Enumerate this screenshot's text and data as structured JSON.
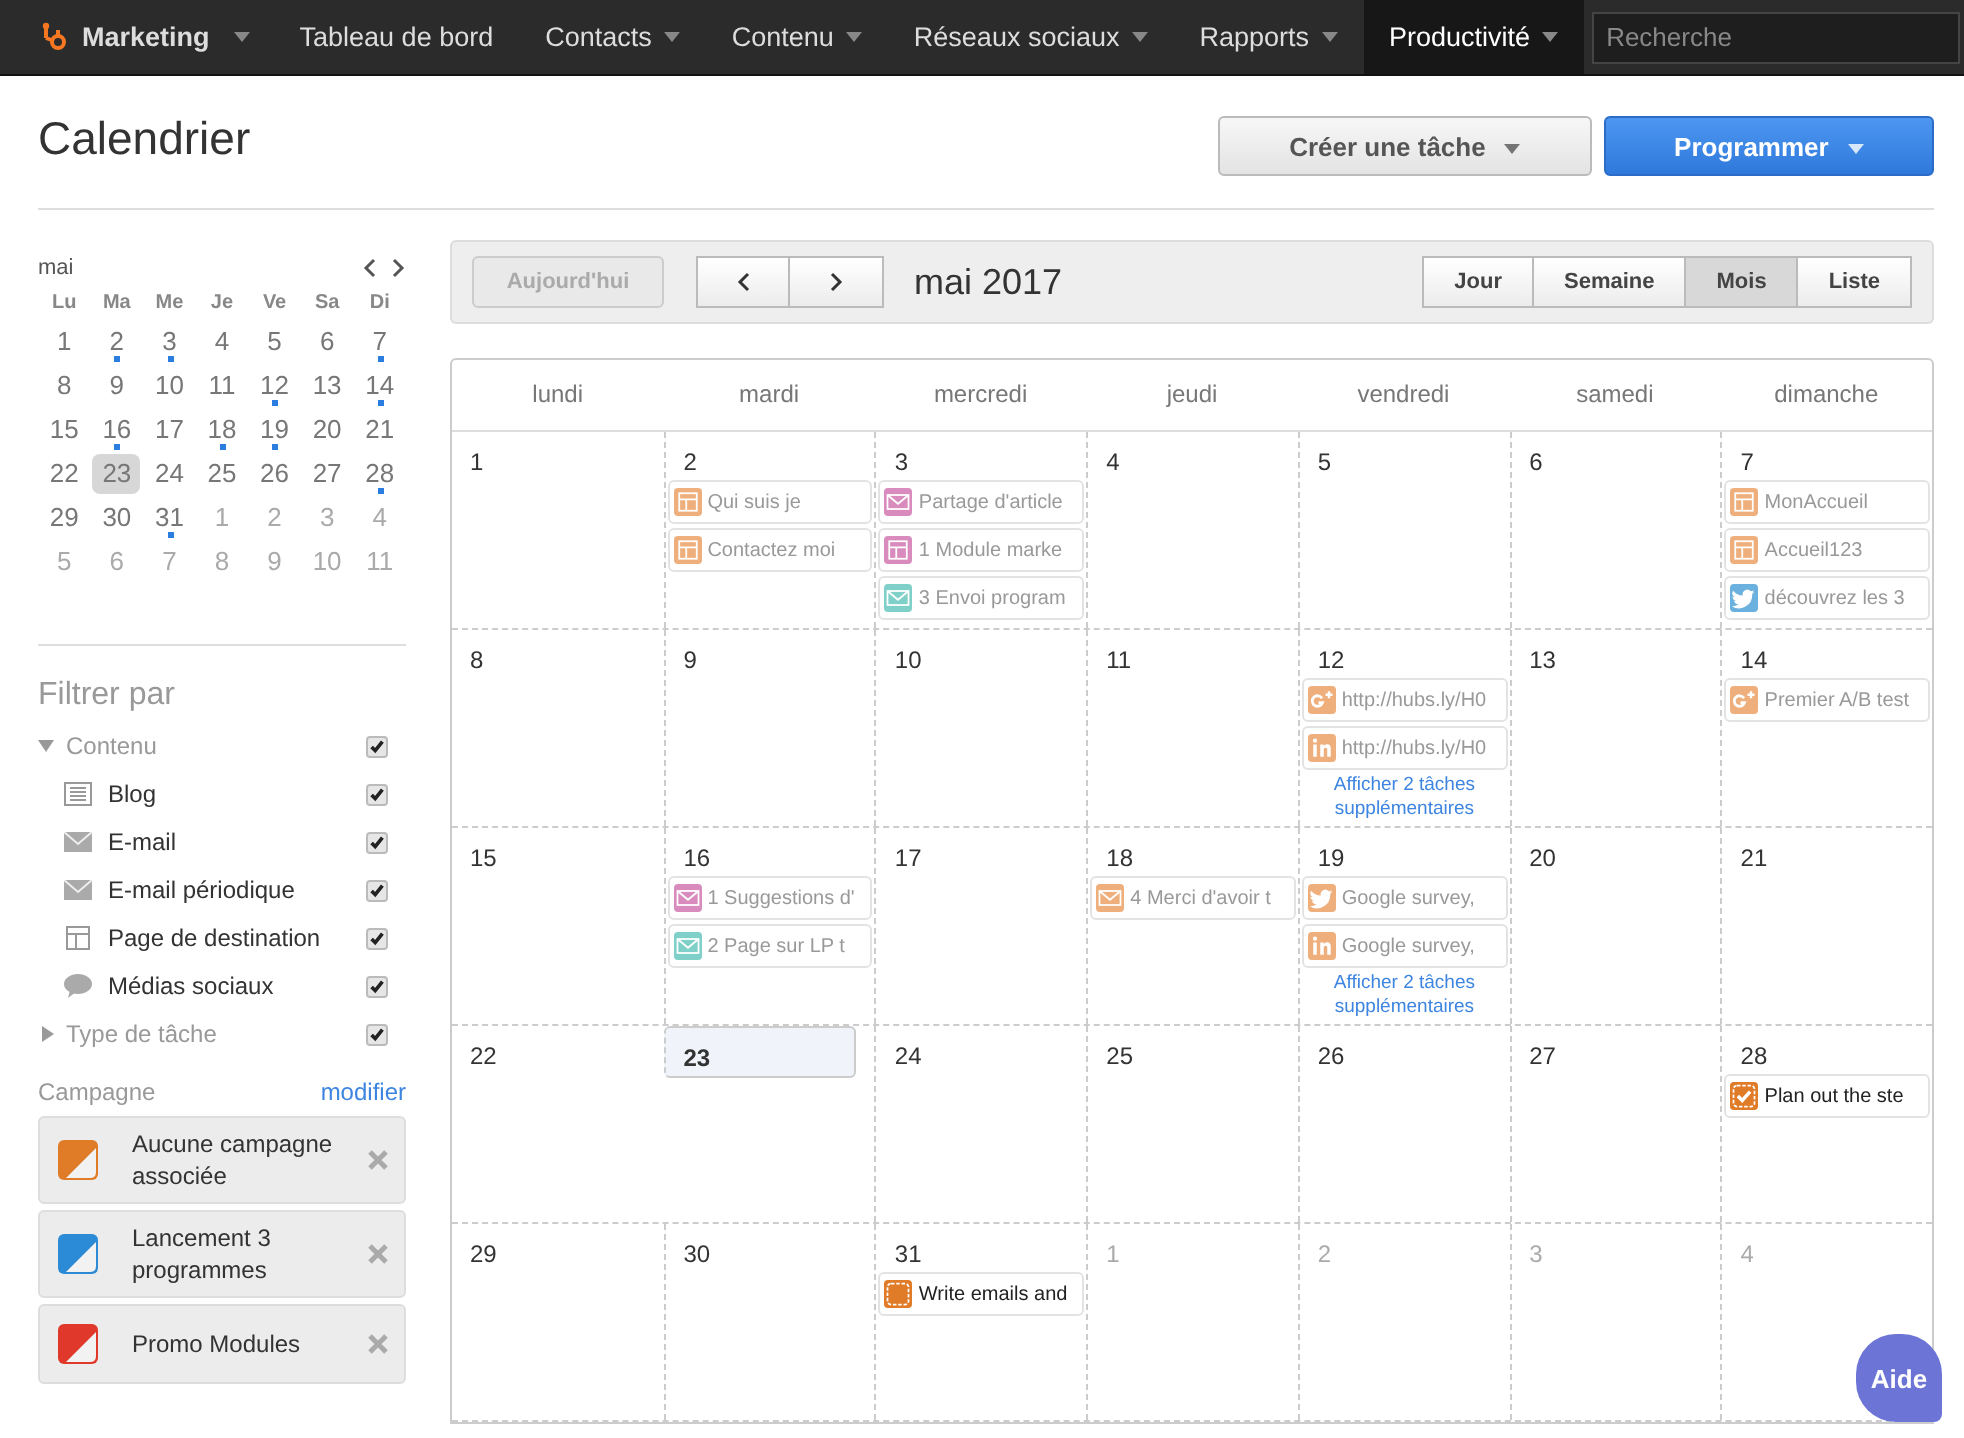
{
  "nav": {
    "brand": "Marketing",
    "items": [
      {
        "label": "Tableau de bord",
        "caret": false,
        "selected": false
      },
      {
        "label": "Contacts",
        "caret": true,
        "selected": false
      },
      {
        "label": "Contenu",
        "caret": true,
        "selected": false
      },
      {
        "label": "Réseaux sociaux",
        "caret": true,
        "selected": false
      },
      {
        "label": "Rapports",
        "caret": true,
        "selected": false
      },
      {
        "label": "Productivité",
        "caret": true,
        "selected": true
      }
    ],
    "search": {
      "placeholder": "Recherche"
    }
  },
  "header": {
    "title": "Calendrier",
    "buttons": [
      {
        "label": "Créer une tâche",
        "kind": "secondary"
      },
      {
        "label": "Programmer",
        "kind": "primary"
      }
    ]
  },
  "mini_calendar": {
    "month": "mai",
    "weekdays": [
      "Lu",
      "Ma",
      "Me",
      "Je",
      "Ve",
      "Sa",
      "Di"
    ],
    "days": [
      {
        "label": "1",
        "muted": false,
        "dot": false,
        "selected": false
      },
      {
        "label": "2",
        "muted": false,
        "dot": true,
        "selected": false
      },
      {
        "label": "3",
        "muted": false,
        "dot": true,
        "selected": false
      },
      {
        "label": "4",
        "muted": false,
        "dot": false,
        "selected": false
      },
      {
        "label": "5",
        "muted": false,
        "dot": false,
        "selected": false
      },
      {
        "label": "6",
        "muted": false,
        "dot": false,
        "selected": false
      },
      {
        "label": "7",
        "muted": false,
        "dot": true,
        "selected": false
      },
      {
        "label": "8",
        "muted": false,
        "dot": false,
        "selected": false
      },
      {
        "label": "9",
        "muted": false,
        "dot": false,
        "selected": false
      },
      {
        "label": "10",
        "muted": false,
        "dot": false,
        "selected": false
      },
      {
        "label": "11",
        "muted": false,
        "dot": false,
        "selected": false
      },
      {
        "label": "12",
        "muted": false,
        "dot": true,
        "selected": false
      },
      {
        "label": "13",
        "muted": false,
        "dot": false,
        "selected": false
      },
      {
        "label": "14",
        "muted": false,
        "dot": true,
        "selected": false
      },
      {
        "label": "15",
        "muted": false,
        "dot": false,
        "selected": false
      },
      {
        "label": "16",
        "muted": false,
        "dot": true,
        "selected": false
      },
      {
        "label": "17",
        "muted": false,
        "dot": false,
        "selected": false
      },
      {
        "label": "18",
        "muted": false,
        "dot": true,
        "selected": false
      },
      {
        "label": "19",
        "muted": false,
        "dot": true,
        "selected": false
      },
      {
        "label": "20",
        "muted": false,
        "dot": false,
        "selected": false
      },
      {
        "label": "21",
        "muted": false,
        "dot": false,
        "selected": false
      },
      {
        "label": "22",
        "muted": false,
        "dot": false,
        "selected": false
      },
      {
        "label": "23",
        "muted": false,
        "dot": false,
        "selected": true
      },
      {
        "label": "24",
        "muted": false,
        "dot": false,
        "selected": false
      },
      {
        "label": "25",
        "muted": false,
        "dot": false,
        "selected": false
      },
      {
        "label": "26",
        "muted": false,
        "dot": false,
        "selected": false
      },
      {
        "label": "27",
        "muted": false,
        "dot": false,
        "selected": false
      },
      {
        "label": "28",
        "muted": false,
        "dot": true,
        "selected": false
      },
      {
        "label": "29",
        "muted": false,
        "dot": false,
        "selected": false
      },
      {
        "label": "30",
        "muted": false,
        "dot": false,
        "selected": false
      },
      {
        "label": "31",
        "muted": false,
        "dot": true,
        "selected": false
      },
      {
        "label": "1",
        "muted": true,
        "dot": false,
        "selected": false
      },
      {
        "label": "2",
        "muted": true,
        "dot": false,
        "selected": false
      },
      {
        "label": "3",
        "muted": true,
        "dot": false,
        "selected": false
      },
      {
        "label": "4",
        "muted": true,
        "dot": false,
        "selected": false
      },
      {
        "label": "5",
        "muted": true,
        "dot": false,
        "selected": false
      },
      {
        "label": "6",
        "muted": true,
        "dot": false,
        "selected": false
      },
      {
        "label": "7",
        "muted": true,
        "dot": false,
        "selected": false
      },
      {
        "label": "8",
        "muted": true,
        "dot": false,
        "selected": false
      },
      {
        "label": "9",
        "muted": true,
        "dot": false,
        "selected": false
      },
      {
        "label": "10",
        "muted": true,
        "dot": false,
        "selected": false
      },
      {
        "label": "11",
        "muted": true,
        "dot": false,
        "selected": false
      }
    ]
  },
  "filters": {
    "title": "Filtrer par",
    "groups": [
      {
        "label": "Contenu",
        "expanded": true,
        "checked": true,
        "children": [
          {
            "label": "Blog",
            "kind": "blog",
            "checked": true
          },
          {
            "label": "E-mail",
            "kind": "email",
            "checked": true
          },
          {
            "label": "E-mail périodique",
            "kind": "email",
            "checked": true
          },
          {
            "label": "Page de destination",
            "kind": "page",
            "checked": true
          },
          {
            "label": "Médias sociaux",
            "kind": "social",
            "checked": true
          }
        ]
      },
      {
        "label": "Type de tâche",
        "expanded": false,
        "checked": true
      }
    ]
  },
  "campaigns": {
    "title": "Campagne",
    "edit_link": "modifier",
    "items": [
      {
        "name": "Aucune campagne associée",
        "color": "#e07b27"
      },
      {
        "name": "Lancement 3 programmes",
        "color": "#2c8bd6"
      },
      {
        "name": "Promo Modules",
        "color": "#e0392b"
      }
    ]
  },
  "toolbar": {
    "today": {
      "label": "Aujourd'hui",
      "disabled": true
    },
    "title": "mai 2017",
    "views": [
      {
        "label": "Jour",
        "selected": false
      },
      {
        "label": "Semaine",
        "selected": false
      },
      {
        "label": "Mois",
        "selected": true
      },
      {
        "label": "Liste",
        "selected": false
      }
    ]
  },
  "calendar": {
    "weekdays": [
      "lundi",
      "mardi",
      "mercredi",
      "jeudi",
      "vendredi",
      "samedi",
      "dimanche"
    ],
    "weeks": [
      [
        {
          "label": "1",
          "muted": false,
          "today": false
        },
        {
          "label": "2",
          "muted": false,
          "today": false,
          "events": [
            {
              "kind": "page",
              "color": "#eeaf7c",
              "label": "Qui suis je"
            },
            {
              "kind": "page",
              "color": "#eeaf7c",
              "label": "Contactez moi"
            }
          ]
        },
        {
          "label": "3",
          "muted": false,
          "today": false,
          "events": [
            {
              "kind": "email",
              "color": "#d98bbd",
              "label": "Partage d'article"
            },
            {
              "kind": "page",
              "color": "#d98bbd",
              "label": "1 Module marke"
            },
            {
              "kind": "email",
              "color": "#7fd0c8",
              "label": "3 Envoi program"
            }
          ]
        },
        {
          "label": "4",
          "muted": false,
          "today": false
        },
        {
          "label": "5",
          "muted": false,
          "today": false
        },
        {
          "label": "6",
          "muted": false,
          "today": false
        },
        {
          "label": "7",
          "muted": false,
          "today": false,
          "events": [
            {
              "kind": "page",
              "color": "#eeaf7c",
              "label": "MonAccueil"
            },
            {
              "kind": "page",
              "color": "#eeaf7c",
              "label": "Accueil123"
            },
            {
              "kind": "twitter",
              "color": "#6bb1df",
              "label": "découvrez les 3"
            }
          ]
        }
      ],
      [
        {
          "label": "8",
          "muted": false,
          "today": false
        },
        {
          "label": "9",
          "muted": false,
          "today": false
        },
        {
          "label": "10",
          "muted": false,
          "today": false
        },
        {
          "label": "11",
          "muted": false,
          "today": false
        },
        {
          "label": "12",
          "muted": false,
          "today": false,
          "events": [
            {
              "kind": "gplus",
              "color": "#eeaf7c",
              "label": "http://hubs.ly/H0"
            },
            {
              "kind": "linkedin",
              "color": "#eeaf7c",
              "label": "http://hubs.ly/H0"
            }
          ],
          "more": "Afficher 2 tâches supplémentaires"
        },
        {
          "label": "13",
          "muted": false,
          "today": false
        },
        {
          "label": "14",
          "muted": false,
          "today": false,
          "events": [
            {
              "kind": "gplus",
              "color": "#eeaf7c",
              "label": "Premier A/B test"
            }
          ]
        }
      ],
      [
        {
          "label": "15",
          "muted": false,
          "today": false
        },
        {
          "label": "16",
          "muted": false,
          "today": false,
          "events": [
            {
              "kind": "email",
              "color": "#d98bbd",
              "label": "1 Suggestions d'"
            },
            {
              "kind": "email",
              "color": "#7fd0c8",
              "label": "2 Page sur LP t"
            }
          ]
        },
        {
          "label": "17",
          "muted": false,
          "today": false
        },
        {
          "label": "18",
          "muted": false,
          "today": false,
          "events": [
            {
              "kind": "email",
              "color": "#eeaf7c",
              "label": "4 Merci d'avoir t"
            }
          ]
        },
        {
          "label": "19",
          "muted": false,
          "today": false,
          "events": [
            {
              "kind": "twitter",
              "color": "#eeaf7c",
              "label": "Google survey,"
            },
            {
              "kind": "linkedin",
              "color": "#eeaf7c",
              "label": "Google survey,"
            }
          ],
          "more": "Afficher 2 tâches supplémentaires"
        },
        {
          "label": "20",
          "muted": false,
          "today": false
        },
        {
          "label": "21",
          "muted": false,
          "today": false
        }
      ],
      [
        {
          "label": "22",
          "muted": false,
          "today": false
        },
        {
          "label": "23",
          "muted": false,
          "today": true
        },
        {
          "label": "24",
          "muted": false,
          "today": false
        },
        {
          "label": "25",
          "muted": false,
          "today": false
        },
        {
          "label": "26",
          "muted": false,
          "today": false
        },
        {
          "label": "27",
          "muted": false,
          "today": false
        },
        {
          "label": "28",
          "muted": false,
          "today": false,
          "events": [
            {
              "kind": "task",
              "color": "#e07b27",
              "label": "Plan out the ste",
              "done": true
            }
          ]
        }
      ],
      [
        {
          "label": "29",
          "muted": false,
          "today": false
        },
        {
          "label": "30",
          "muted": false,
          "today": false
        },
        {
          "label": "31",
          "muted": false,
          "today": false,
          "events": [
            {
              "kind": "task",
              "color": "#e07b27",
              "label": "Write emails and",
              "done": false
            }
          ]
        },
        {
          "label": "1",
          "muted": true,
          "today": false
        },
        {
          "label": "2",
          "muted": true,
          "today": false
        },
        {
          "label": "3",
          "muted": true,
          "today": false
        },
        {
          "label": "4",
          "muted": true,
          "today": false
        }
      ]
    ]
  },
  "help_button": {
    "label": "Aide"
  }
}
